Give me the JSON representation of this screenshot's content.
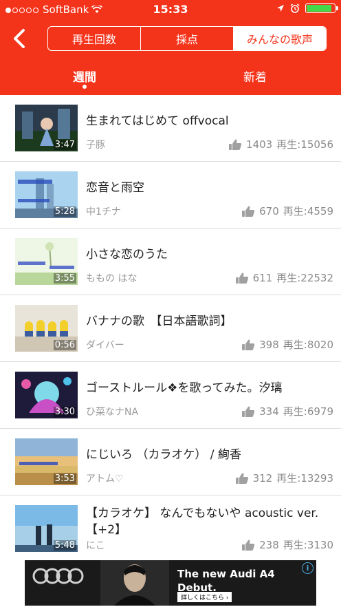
{
  "status_bar": {
    "carrier": "SoftBank",
    "time": "15:33",
    "signal_bars_filled": 1,
    "signal_bars_total": 5,
    "battery_level": 0.9
  },
  "header": {
    "segments": [
      "再生回数",
      "採点",
      "みんなの歌声"
    ],
    "selected_segment": "みんなの歌声",
    "tabs": [
      "週間",
      "新着"
    ],
    "active_tab": "週間"
  },
  "items": [
    {
      "title": "生まれてはじめて offvocal",
      "user": "子豚",
      "likes": "1403",
      "plays": "再生:15056",
      "duration": "3:47"
    },
    {
      "title": "恋音と雨空",
      "user": "中1チナ",
      "likes": "670",
      "plays": "再生:4559",
      "duration": "5:28"
    },
    {
      "title": "小さな恋のうた",
      "user": "ももの はな",
      "likes": "611",
      "plays": "再生:22532",
      "duration": "3:55"
    },
    {
      "title": "バナナの歌　【日本語歌詞】",
      "user": "ダイバー",
      "likes": "398",
      "plays": "再生:8020",
      "duration": "0:56"
    },
    {
      "title": "ゴーストルール❖を歌ってみた。汐璃",
      "user": "ひ菜なナNA",
      "likes": "334",
      "plays": "再生:6979",
      "duration": "3:30"
    },
    {
      "title": "にじいろ （カラオケ） / 絢香",
      "user": "アトム♡",
      "likes": "312",
      "plays": "再生:13293",
      "duration": "3:53"
    },
    {
      "title": "【カラオケ】 なんでもないや acoustic ver. 【+2】",
      "user": "にこ",
      "likes": "238",
      "plays": "再生:3130",
      "duration": "5:48"
    }
  ],
  "ad": {
    "headline": "The new Audi A4 Debut.",
    "cta": "詳しくはこちら ›",
    "info": "i"
  },
  "colors": {
    "accent": "#f4331b",
    "battery": "#44d94a"
  }
}
